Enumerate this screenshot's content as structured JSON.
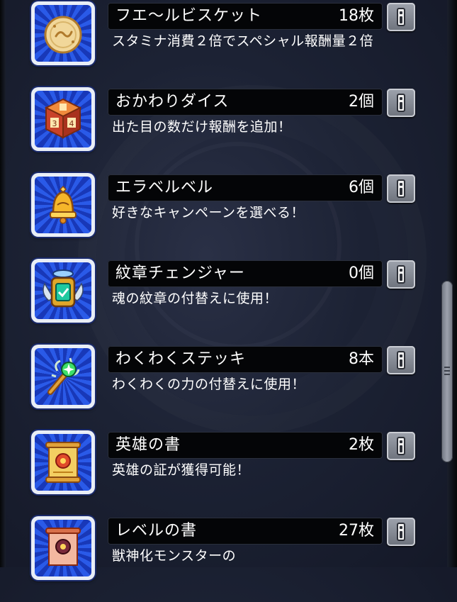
{
  "items": [
    {
      "icon": "biscuit-icon",
      "name": "フエ〜ルビスケット",
      "count": "18枚",
      "description": "スタミナ消費２倍でスペシャル報酬量２倍"
    },
    {
      "icon": "dice-icon",
      "name": "おかわりダイス",
      "count": "2個",
      "description": "出た目の数だけ報酬を追加！"
    },
    {
      "icon": "bell-icon",
      "name": "エラベルベル",
      "count": "6個",
      "description": "好きなキャンペーンを選べる！"
    },
    {
      "icon": "emblem-changer-icon",
      "name": "紋章チェンジャー",
      "count": "0個",
      "description": "魂の紋章の付替えに使用！"
    },
    {
      "icon": "magic-stick-icon",
      "name": "わくわくステッキ",
      "count": "8本",
      "description": "わくわくの力の付替えに使用！"
    },
    {
      "icon": "scroll-icon",
      "name": "英雄の書",
      "count": "2枚",
      "description": "英雄の証が獲得可能！"
    },
    {
      "icon": "scroll-icon",
      "name": "レベルの書",
      "count": "27枚",
      "description": "獣神化モンスターの"
    }
  ],
  "colors": {
    "background": "#1c2234",
    "name_bar": "#040507",
    "icon_blue": "#2a5ae8",
    "info_button": "#8a8f99"
  }
}
